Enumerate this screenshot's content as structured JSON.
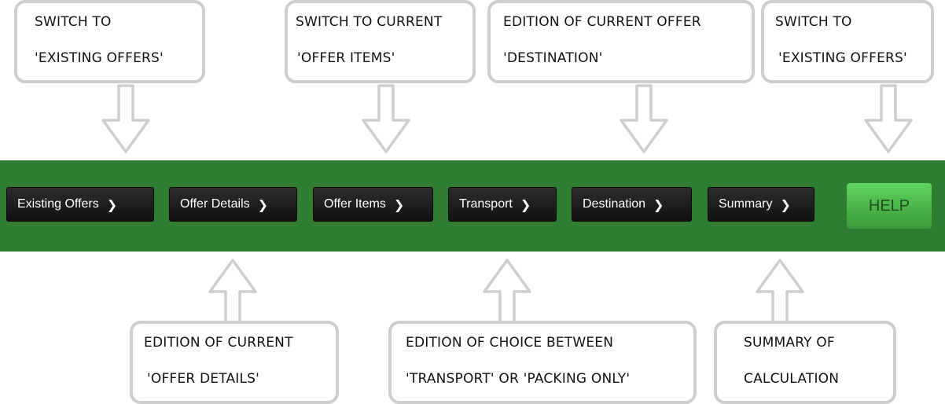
{
  "nav": {
    "items": [
      {
        "label": "Existing Offers"
      },
      {
        "label": "Offer Details"
      },
      {
        "label": "Offer Items"
      },
      {
        "label": "Transport"
      },
      {
        "label": "Destination"
      },
      {
        "label": "Summary"
      }
    ],
    "help_label": "HELP",
    "chevron": "chevron-right-icon"
  },
  "callouts_top": [
    {
      "line1": "SWITCH TO",
      "line2": "'EXISTING OFFERS'"
    },
    {
      "line1": "SWITCH TO CURRENT",
      "line2": "'OFFER ITEMS'"
    },
    {
      "line1": "EDITION OF CURRENT OFFER",
      "line2": "'DESTINATION'"
    },
    {
      "line1": "SWITCH TO",
      "line2": "'EXISTING OFFERS'"
    }
  ],
  "callouts_bottom": [
    {
      "line1": "EDITION OF CURRENT",
      "line2": "'OFFER DETAILS'"
    },
    {
      "line1": "EDITION OF CHOICE BETWEEN",
      "line2": "'TRANSPORT' OR 'PACKING ONLY'"
    },
    {
      "line1": "SUMMARY OF",
      "line2": "CALCULATION"
    }
  ],
  "colors": {
    "bar": "#2e7d32",
    "button": "#1a1a1a",
    "help": "#4cbb4c",
    "callout_border": "#cfcfcf"
  }
}
